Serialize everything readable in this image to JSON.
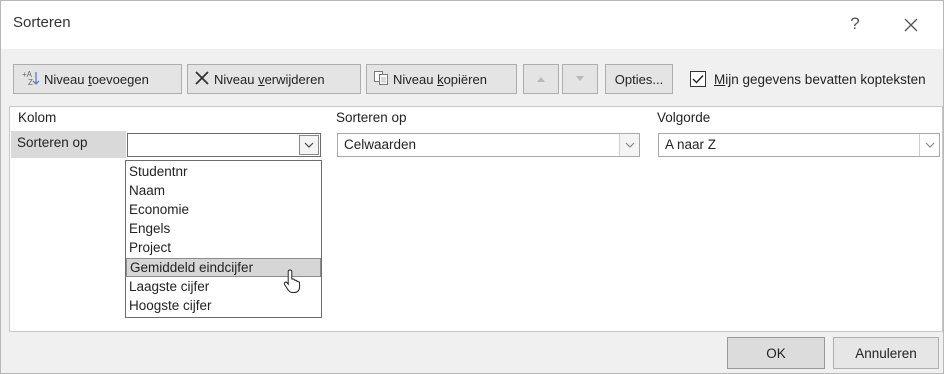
{
  "dialog": {
    "title": "Sorteren",
    "help_label": "?"
  },
  "toolbar": {
    "add_level": {
      "pre": "Niveau ",
      "key": "t",
      "post": "oevoegen"
    },
    "delete_level": {
      "pre": "Niveau ",
      "key": "v",
      "post": "erwijderen"
    },
    "copy_level": {
      "pre": "Niveau ",
      "key": "k",
      "post": "opiëren"
    },
    "options_label": "Opties...",
    "header_checkbox": {
      "key": "M",
      "post": "ijn gegevens bevatten kopteksten",
      "checked": true
    }
  },
  "grid": {
    "headers": {
      "column": "Kolom",
      "sort_on": "Sorteren op",
      "order": "Volgorde"
    },
    "rows": [
      {
        "label": "Sorteren op",
        "column_value": "",
        "sort_on_value": "Celwaarden",
        "order_value": "A naar Z"
      }
    ]
  },
  "dropdown": {
    "items": [
      "Studentnr",
      "Naam",
      "Economie",
      "Engels",
      "Project",
      "Gemiddeld eindcijfer",
      "Laagste cijfer",
      "Hoogste cijfer"
    ],
    "highlighted": "Gemiddeld eindcijfer"
  },
  "footer": {
    "ok_label": "OK",
    "cancel_label": "Annuleren"
  }
}
